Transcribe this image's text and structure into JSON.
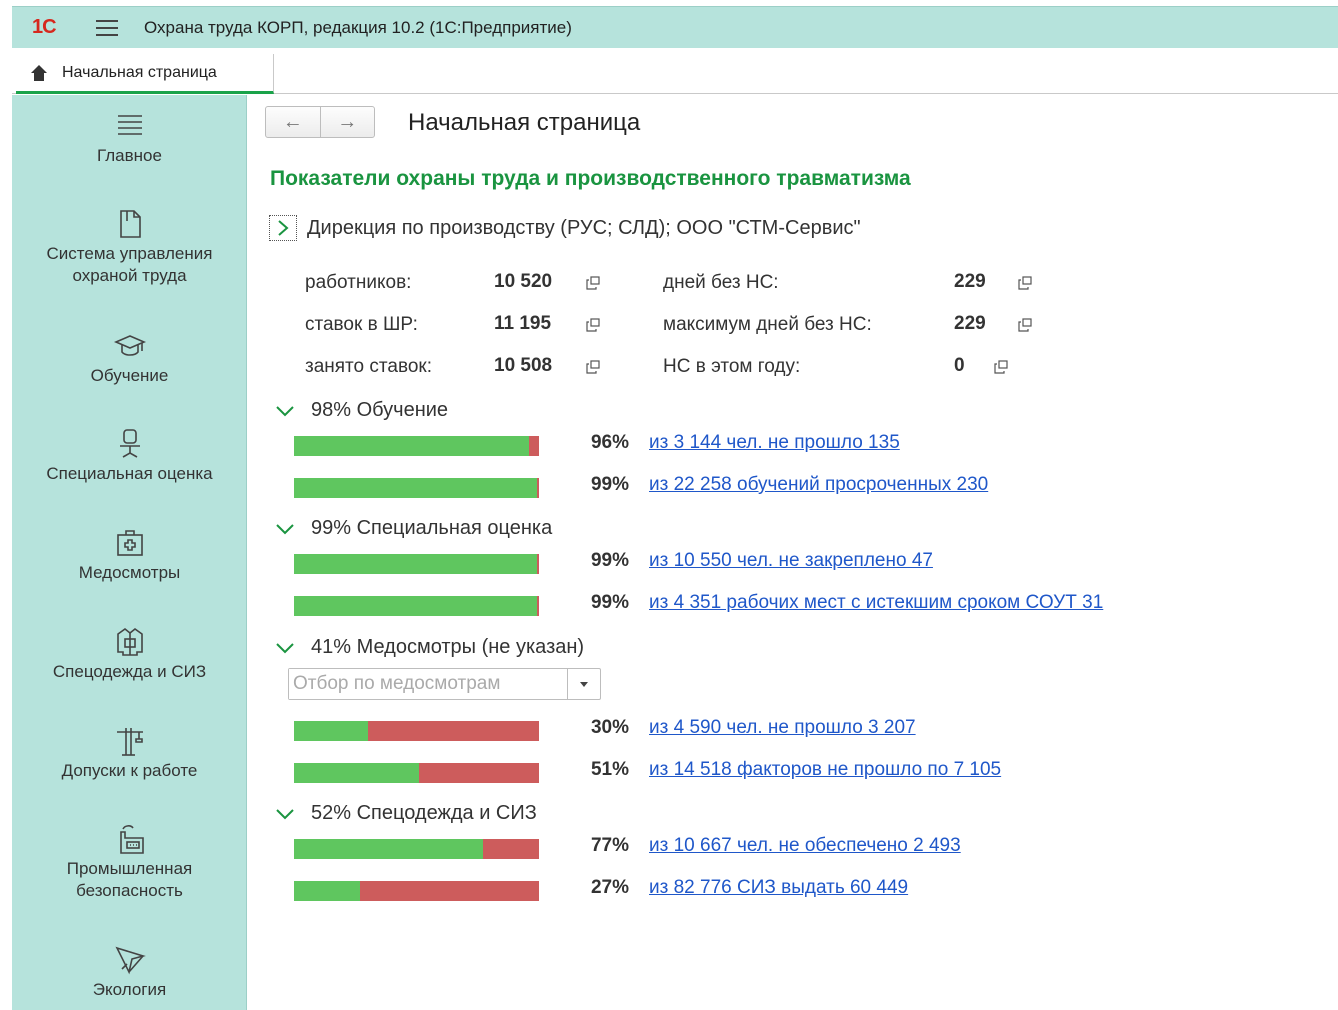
{
  "app": {
    "title": "Охрана труда КОРП, редакция 10.2  (1С:Предприятие)",
    "logo": "1С"
  },
  "tabs": [
    {
      "label": "Начальная страница",
      "icon": "home-icon",
      "active": true
    }
  ],
  "sidebar": {
    "items": [
      {
        "label": "Главное",
        "icon": "lines-icon"
      },
      {
        "label": "Система управления охраной труда",
        "icon": "document-icon"
      },
      {
        "label": "Обучение",
        "icon": "graduation-cap-icon"
      },
      {
        "label": "Специальная оценка",
        "icon": "office-chair-icon"
      },
      {
        "label": "Медосмотры",
        "icon": "first-aid-kit-icon"
      },
      {
        "label": "Спецодежда и СИЗ",
        "icon": "workwear-jacket-icon"
      },
      {
        "label": "Допуски к работе",
        "icon": "crane-icon"
      },
      {
        "label": "Промышленная безопасность",
        "icon": "factory-icon"
      },
      {
        "label": "Экология",
        "icon": "eco-plane-icon"
      }
    ]
  },
  "main": {
    "page_title": "Начальная страница",
    "section_title": "Показатели охраны труда и производственного травматизма",
    "organization": "Дирекция по производству (РУС; СЛД); ООО \"СТМ-Сервис\"",
    "stats": [
      {
        "label": "работников:",
        "value": "10 520"
      },
      {
        "label": "ставок в ШР:",
        "value": "11 195"
      },
      {
        "label": "занято ставок:",
        "value": "10 508"
      },
      {
        "label": "дней без НС:",
        "value": "229"
      },
      {
        "label": "максимум дней без НС:",
        "value": "229"
      },
      {
        "label": "НС в этом году:",
        "value": "0"
      }
    ],
    "groups": [
      {
        "title": "98% Обучение",
        "rows": [
          {
            "fill": 0.96,
            "pct": "96%",
            "link": "из 3 144 чел. не прошло 135"
          },
          {
            "fill": 0.99,
            "pct": "99%",
            "link": "из 22 258 обучений просроченных 230"
          }
        ]
      },
      {
        "title": "99% Специальная оценка",
        "rows": [
          {
            "fill": 0.99,
            "pct": "99%",
            "link": "из 10 550 чел. не закреплено 47"
          },
          {
            "fill": 0.99,
            "pct": "99%",
            "link": "из 4 351 рабочих мест с истекшим сроком СОУТ 31"
          }
        ]
      },
      {
        "title": "41% Медосмотры (не указан)",
        "filter_placeholder": "Отбор по медосмотрам",
        "rows": [
          {
            "fill": 0.3,
            "pct": "30%",
            "link": "из 4 590 чел. не прошло 3 207"
          },
          {
            "fill": 0.51,
            "pct": "51%",
            "link": "из 14 518 факторов не прошло по 7 105"
          }
        ]
      },
      {
        "title": "52% Спецодежда и СИЗ",
        "rows": [
          {
            "fill": 0.77,
            "pct": "77%",
            "link": "из 10 667 чел. не обеспечено 2 493"
          },
          {
            "fill": 0.27,
            "pct": "27%",
            "link": "из 82 776 СИЗ выдать 60 449"
          }
        ]
      }
    ]
  },
  "colors": {
    "accent_green": "#1a9440",
    "bar_fill": "#5fc65f",
    "bar_rest": "#cd5c5c",
    "link": "#1f57c9",
    "panel": "#b6e3dc"
  }
}
